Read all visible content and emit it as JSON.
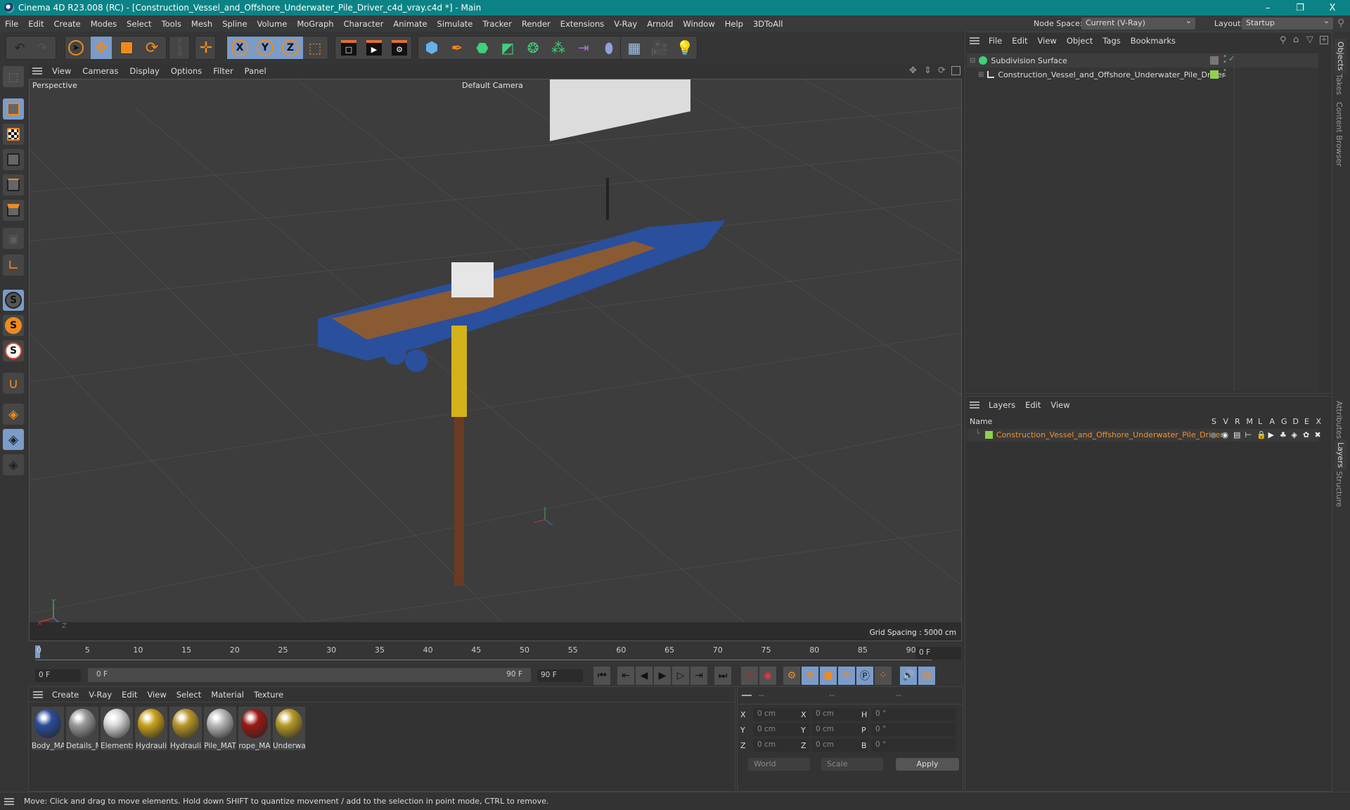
{
  "window": {
    "title": "Cinema 4D R23.008 (RC) - [Construction_Vessel_and_Offshore_Underwater_Pile_Driver_c4d_vray.c4d *] - Main",
    "minimize": "–",
    "restore": "❐",
    "close": "X"
  },
  "menubar": {
    "items": [
      "File",
      "Edit",
      "Create",
      "Modes",
      "Select",
      "Tools",
      "Mesh",
      "Spline",
      "Volume",
      "MoGraph",
      "Character",
      "Animate",
      "Simulate",
      "Tracker",
      "Render",
      "Extensions",
      "V-Ray",
      "Arnold",
      "Window",
      "Help",
      "3DToAll"
    ],
    "node_space_label": "Node Space:",
    "node_space_value": "Current (V-Ray)",
    "layout_label": "Layout:",
    "layout_value": "Startup"
  },
  "toolbar": {
    "undo": "undo-icon",
    "redo": "redo-icon",
    "tools": [
      "select-icon",
      "move-icon",
      "scale-icon",
      "rotate-icon",
      "psr-icon",
      "add-icon"
    ],
    "axis": [
      "X",
      "Y",
      "Z"
    ],
    "coord_system": "coordinate-system-icon",
    "render": [
      "render-view-icon",
      "render-to-picture-viewer-icon",
      "render-settings-icon"
    ],
    "objects": [
      "cube-icon",
      "pen-icon",
      "subdivision-icon",
      "extrude-icon",
      "cloner-icon",
      "mograph-icon",
      "deformer-icon",
      "field-icon",
      "floor-icon",
      "camera-icon",
      "light-icon"
    ]
  },
  "left_tools": [
    "make-editable-icon",
    "model-mode-icon",
    "texture-mode-icon",
    "point-mode-icon",
    "edge-mode-icon",
    "polygon-mode-icon",
    "uv-mode-icon",
    "axis-mode-icon",
    "snap-icon",
    "snap-settings-icon",
    "workplane-snap-icon",
    "magnet-icon",
    "workplane-icon",
    "locked-workplane-icon",
    "planar-workplane-icon"
  ],
  "viewport": {
    "menu": [
      "View",
      "Cameras",
      "Display",
      "Options",
      "Filter",
      "Panel"
    ],
    "view_name": "Perspective",
    "camera": "Default Camera",
    "grid_spacing": "Grid Spacing : 5000 cm",
    "axis_labels": {
      "x": "X",
      "y": "Y",
      "z": "Z"
    },
    "nav_icons": [
      "move-view-icon",
      "zoom-view-icon",
      "rotate-view-icon",
      "maximize-view-icon"
    ]
  },
  "timeline": {
    "ticks": [
      "0",
      "5",
      "10",
      "15",
      "20",
      "25",
      "30",
      "35",
      "40",
      "45",
      "50",
      "55",
      "60",
      "65",
      "70",
      "75",
      "80",
      "85",
      "90"
    ],
    "current_frame": "0 F",
    "start_frame": "0 F",
    "range_start": "0 F",
    "range_end": "90 F",
    "end_frame": "90 F",
    "current_frame_percent": 0
  },
  "materials": {
    "menu": [
      "Create",
      "V-Ray",
      "Edit",
      "View",
      "Select",
      "Material",
      "Texture"
    ],
    "items": [
      {
        "label": "Body_MA",
        "color": "#2b4d9a"
      },
      {
        "label": "Details_M",
        "color": "#9a9a9a"
      },
      {
        "label": "Elements",
        "color": "#d8d8d8"
      },
      {
        "label": "Hydrauli",
        "color": "#c9a21c"
      },
      {
        "label": "Hydrauli",
        "color": "#b9962a"
      },
      {
        "label": "Pile_MAT",
        "color": "#b8b8b8"
      },
      {
        "label": "rope_MA",
        "color": "#9a1a14"
      },
      {
        "label": "Underwa",
        "color": "#b89a28"
      }
    ]
  },
  "coordinates": {
    "headers": [
      "--",
      "--",
      "--"
    ],
    "rows": [
      {
        "l1": "X",
        "v1": "0 cm",
        "l2": "X",
        "v2": "0 cm",
        "l3": "H",
        "v3": "0 °"
      },
      {
        "l1": "Y",
        "v1": "0 cm",
        "l2": "Y",
        "v2": "0 cm",
        "l3": "P",
        "v3": "0 °"
      },
      {
        "l1": "Z",
        "v1": "0 cm",
        "l2": "Z",
        "v2": "0 cm",
        "l3": "B",
        "v3": "0 °"
      }
    ],
    "mode": "World",
    "transform": "Scale",
    "apply": "Apply"
  },
  "objects_panel": {
    "menu": [
      "File",
      "Edit",
      "View",
      "Object",
      "Tags",
      "Bookmarks"
    ],
    "items": [
      {
        "name": "Subdivision Surface"
      },
      {
        "name": "Construction_Vessel_and_Offshore_Underwater_Pile_Driver",
        "layer_color": "#8fd14f"
      }
    ]
  },
  "layers_panel": {
    "menu": [
      "Layers",
      "Edit",
      "View"
    ],
    "col_name": "Name",
    "columns": [
      "S",
      "V",
      "R",
      "M",
      "L",
      "A",
      "G",
      "D",
      "E",
      "X"
    ],
    "layers": [
      {
        "name": "Construction_Vessel_and_Offshore_Underwater_Pile_Driver",
        "color": "#8fd14f",
        "text_color": "#f0922e"
      }
    ]
  },
  "side_tabs": {
    "top": [
      "Objects",
      "Takes",
      "Content Browser"
    ],
    "bottom": [
      "Attributes",
      "Layers",
      "Structure"
    ]
  },
  "status": "Move: Click and drag to move elements. Hold down SHIFT to quantize movement / add to the selection in point mode, CTRL to remove."
}
